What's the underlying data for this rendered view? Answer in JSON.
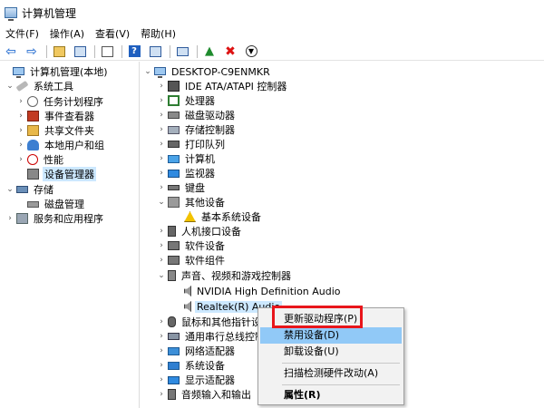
{
  "window": {
    "title": "计算机管理"
  },
  "menu": [
    "文件(F)",
    "操作(A)",
    "查看(V)",
    "帮助(H)"
  ],
  "left_tree": [
    {
      "label": "计算机管理(本地)",
      "icon": "computer-icon",
      "expander": "",
      "level": 0
    },
    {
      "label": "系统工具",
      "icon": "tools-icon",
      "expander": "expanded",
      "level": 1
    },
    {
      "label": "任务计划程序",
      "icon": "clock-icon",
      "expander": "collapsed",
      "level": 2
    },
    {
      "label": "事件查看器",
      "icon": "event-viewer-icon",
      "expander": "collapsed",
      "level": 2
    },
    {
      "label": "共享文件夹",
      "icon": "shared-folder-icon",
      "expander": "collapsed",
      "level": 2
    },
    {
      "label": "本地用户和组",
      "icon": "users-icon",
      "expander": "collapsed",
      "level": 2
    },
    {
      "label": "性能",
      "icon": "performance-icon",
      "expander": "collapsed",
      "level": 2
    },
    {
      "label": "设备管理器",
      "icon": "device-manager-icon",
      "expander": "",
      "level": 2,
      "selected": true
    },
    {
      "label": "存储",
      "icon": "storage-icon",
      "expander": "expanded",
      "level": 1
    },
    {
      "label": "磁盘管理",
      "icon": "disk-icon",
      "expander": "",
      "level": 2
    },
    {
      "label": "服务和应用程序",
      "icon": "services-icon",
      "expander": "collapsed",
      "level": 1
    }
  ],
  "device_tree": [
    {
      "label": "DESKTOP-C9ENMKR",
      "icon": "computer-icon",
      "expander": "expanded",
      "level": 0
    },
    {
      "label": "IDE ATA/ATAPI 控制器",
      "icon": "ide-icon",
      "expander": "collapsed",
      "level": 1
    },
    {
      "label": "处理器",
      "icon": "processor-icon",
      "expander": "collapsed",
      "level": 1
    },
    {
      "label": "磁盘驱动器",
      "icon": "disk-drive-icon",
      "expander": "collapsed",
      "level": 1
    },
    {
      "label": "存储控制器",
      "icon": "storage-controller-icon",
      "expander": "collapsed",
      "level": 1
    },
    {
      "label": "打印队列",
      "icon": "printer-icon",
      "expander": "collapsed",
      "level": 1
    },
    {
      "label": "计算机",
      "icon": "pc-icon",
      "expander": "collapsed",
      "level": 1
    },
    {
      "label": "监视器",
      "icon": "monitor-icon",
      "expander": "collapsed",
      "level": 1
    },
    {
      "label": "键盘",
      "icon": "keyboard-icon",
      "expander": "collapsed",
      "level": 1
    },
    {
      "label": "其他设备",
      "icon": "other-devices-icon",
      "expander": "expanded",
      "level": 1
    },
    {
      "label": "基本系统设备",
      "icon": "warning-device-icon",
      "expander": "",
      "level": 2
    },
    {
      "label": "人机接口设备",
      "icon": "hid-icon",
      "expander": "collapsed",
      "level": 1
    },
    {
      "label": "软件设备",
      "icon": "software-device-icon",
      "expander": "collapsed",
      "level": 1
    },
    {
      "label": "软件组件",
      "icon": "software-component-icon",
      "expander": "collapsed",
      "level": 1
    },
    {
      "label": "声音、视频和游戏控制器",
      "icon": "sound-icon",
      "expander": "expanded",
      "level": 1
    },
    {
      "label": "NVIDIA High Definition Audio",
      "icon": "speaker-icon",
      "expander": "",
      "level": 2
    },
    {
      "label": "Realtek(R) Audio",
      "icon": "speaker-icon",
      "expander": "",
      "level": 2,
      "selected": true
    },
    {
      "label": "鼠标和其他指针设",
      "icon": "mouse-icon",
      "expander": "collapsed",
      "level": 1
    },
    {
      "label": "通用串行总线控制",
      "icon": "usb-icon",
      "expander": "collapsed",
      "level": 1
    },
    {
      "label": "网络适配器",
      "icon": "network-icon",
      "expander": "collapsed",
      "level": 1
    },
    {
      "label": "系统设备",
      "icon": "system-device-icon",
      "expander": "collapsed",
      "level": 1
    },
    {
      "label": "显示适配器",
      "icon": "display-adapter-icon",
      "expander": "collapsed",
      "level": 1
    },
    {
      "label": "音频输入和输出",
      "icon": "audio-io-icon",
      "expander": "collapsed",
      "level": 1
    }
  ],
  "context_menu": {
    "update_driver": "更新驱动程序(P)",
    "disable_device": "禁用设备(D)",
    "uninstall_device": "卸载设备(U)",
    "scan_hardware": "扫描检测硬件改动(A)",
    "properties": "属性(R)"
  },
  "colors": {
    "highlight_box": "#e8151b",
    "menu_hover": "#91c9f7",
    "tree_selected": "#cce8ff"
  }
}
